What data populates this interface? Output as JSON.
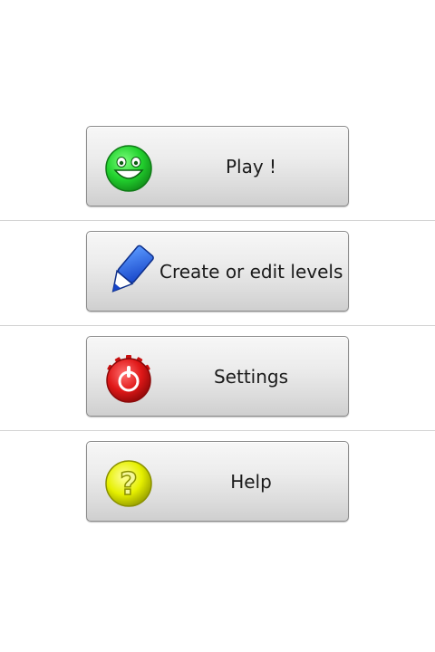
{
  "menu": {
    "items": [
      {
        "label": "Play !",
        "icon": "smiley-face-icon",
        "color": "#22c82e"
      },
      {
        "label": "Create or edit levels",
        "icon": "pencil-icon",
        "color": "#1f5fe0"
      },
      {
        "label": "Settings",
        "icon": "power-gear-icon",
        "color": "#e01818"
      },
      {
        "label": "Help",
        "icon": "question-mark-icon",
        "color": "#e6f000"
      }
    ]
  }
}
